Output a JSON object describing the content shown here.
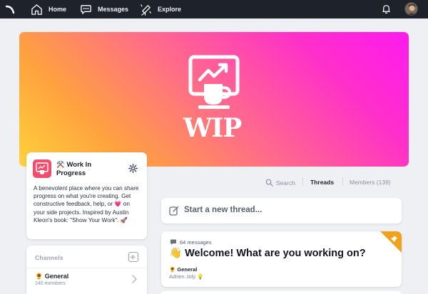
{
  "nav": {
    "home_label": "Home",
    "messages_label": "Messages",
    "explore_label": "Explore",
    "icons": [
      "logo-icon",
      "home-icon",
      "messages-icon",
      "explore-icon",
      "bell-icon",
      "avatar"
    ]
  },
  "banner": {
    "wordmark": "WIP",
    "colors": [
      "#ffd23a",
      "#ff6a8c",
      "#ff1af0"
    ]
  },
  "community": {
    "name": "⚒️ Work In Progress",
    "description": "A benevolent place where you can share progress on what you're creating. Get constructive feedback, help, or 💗 on your side projects. Inspired by Austin Kleon's book: \"Show Your Work\". 🚀"
  },
  "channels": {
    "title": "Channels",
    "items": [
      {
        "name": "🌻 General",
        "meta": "140 members"
      }
    ]
  },
  "tabs": {
    "search": "Search",
    "threads": "Threads",
    "members": "Members (139)"
  },
  "composer": {
    "placeholder": "Start a new thread..."
  },
  "thread": {
    "count": "64 messages",
    "title": "👋 Welcome! What are you working on?",
    "channel": "🌻 General",
    "author": "Adrien Joly 💡",
    "pinned_color": "#f0a21c"
  }
}
